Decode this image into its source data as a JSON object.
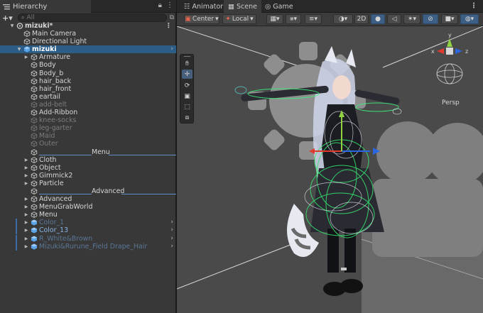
{
  "hierarchy": {
    "tab_label": "Hierarchy",
    "add_label": "+▾",
    "search_placeholder": "All",
    "items": [
      {
        "label": "mizuki*",
        "depth": 0,
        "arrow": "open",
        "icon": "unity-scene-icon",
        "kind": "scene"
      },
      {
        "label": "Main Camera",
        "depth": 1,
        "arrow": "none",
        "icon": "gameobject-cube-icon"
      },
      {
        "label": "Directional Light",
        "depth": 1,
        "arrow": "none",
        "icon": "gameobject-cube-icon"
      },
      {
        "label": "mizuki",
        "depth": 1,
        "arrow": "open",
        "icon": "prefab-cube-icon",
        "selected": true,
        "chevron": true
      },
      {
        "label": "Armature",
        "depth": 2,
        "arrow": "closed",
        "icon": "gameobject-cube-icon"
      },
      {
        "label": "Body",
        "depth": 2,
        "arrow": "none",
        "icon": "gameobject-cube-icon"
      },
      {
        "label": "Body_b",
        "depth": 2,
        "arrow": "none",
        "icon": "gameobject-cube-icon"
      },
      {
        "label": "hair_back",
        "depth": 2,
        "arrow": "none",
        "icon": "gameobject-cube-icon"
      },
      {
        "label": "hair_front",
        "depth": 2,
        "arrow": "none",
        "icon": "gameobject-cube-icon"
      },
      {
        "label": "eartail",
        "depth": 2,
        "arrow": "none",
        "icon": "gameobject-cube-icon"
      },
      {
        "label": "add-belt",
        "depth": 2,
        "arrow": "none",
        "icon": "gameobject-cube-icon",
        "inactive": true
      },
      {
        "label": "Add-Ribbon",
        "depth": 2,
        "arrow": "none",
        "icon": "gameobject-cube-icon"
      },
      {
        "label": "knee-socks",
        "depth": 2,
        "arrow": "none",
        "icon": "gameobject-cube-icon",
        "inactive": true
      },
      {
        "label": "leg-garter",
        "depth": 2,
        "arrow": "none",
        "icon": "gameobject-cube-icon",
        "inactive": true
      },
      {
        "label": "Maid",
        "depth": 2,
        "arrow": "none",
        "icon": "gameobject-cube-icon",
        "inactive": true
      },
      {
        "label": "Outer",
        "depth": 2,
        "arrow": "none",
        "icon": "gameobject-cube-icon",
        "inactive": true
      },
      {
        "label": "Menu",
        "depth": 2,
        "arrow": "none",
        "icon": "gameobject-cube-icon",
        "separator": true
      },
      {
        "label": "Cloth",
        "depth": 2,
        "arrow": "closed",
        "icon": "gameobject-cube-icon"
      },
      {
        "label": "Object",
        "depth": 2,
        "arrow": "closed",
        "icon": "gameobject-cube-icon"
      },
      {
        "label": "Gimmick2",
        "depth": 2,
        "arrow": "closed",
        "icon": "gameobject-cube-icon"
      },
      {
        "label": "Particle",
        "depth": 2,
        "arrow": "closed",
        "icon": "gameobject-cube-icon"
      },
      {
        "label": "Advanced",
        "depth": 2,
        "arrow": "none",
        "icon": "gameobject-cube-icon",
        "separator": true
      },
      {
        "label": "Advanced",
        "depth": 2,
        "arrow": "closed",
        "icon": "gameobject-cube-icon"
      },
      {
        "label": "MenuGrabWorld",
        "depth": 2,
        "arrow": "closed",
        "icon": "gameobject-cube-icon"
      },
      {
        "label": "Menu",
        "depth": 2,
        "arrow": "closed",
        "icon": "gameobject-cube-icon"
      },
      {
        "label": "Color_1",
        "depth": 2,
        "arrow": "closed",
        "icon": "prefab-cube-icon",
        "prefab": true,
        "inactive": true,
        "chevron": true,
        "mark": true
      },
      {
        "label": "Color_13",
        "depth": 2,
        "arrow": "closed",
        "icon": "prefab-cube-icon",
        "prefab": true,
        "chevron": true,
        "mark": true
      },
      {
        "label": "R_White&Brown",
        "depth": 2,
        "arrow": "closed",
        "icon": "prefab-cube-icon",
        "prefab": true,
        "inactive": true,
        "chevron": true,
        "mark": true
      },
      {
        "label": "Mizuki&Rurune_Field Drape_Hair",
        "depth": 2,
        "arrow": "closed",
        "icon": "prefab-cube-icon",
        "prefab": true,
        "inactive": true,
        "chevron": true,
        "mark": true
      }
    ]
  },
  "scene_panel": {
    "tabs": [
      {
        "label": "Animator",
        "icon": "animator-icon",
        "active": false
      },
      {
        "label": "Scene",
        "icon": "scene-grid-icon",
        "active": true
      },
      {
        "label": "Game",
        "icon": "game-controller-icon",
        "active": false
      }
    ],
    "toolbar": {
      "pivot_mode": "Center",
      "pivot_rotation": "Local",
      "mode_2d": "2D"
    },
    "gizmo": {
      "projection_label": "Persp",
      "axes": {
        "y": "y",
        "x": "x",
        "z": "z"
      }
    },
    "tools": [
      "hand-tool-icon",
      "move-tool-icon",
      "rotate-tool-icon",
      "scale-tool-icon",
      "rect-tool-icon",
      "transform-tool-icon"
    ],
    "active_tool": "move-tool-icon"
  },
  "colors": {
    "selection": "#2c5d87",
    "prefab_text": "#87b4e8",
    "x_axis": "#e03a2e",
    "y_axis": "#8fd13f",
    "z_axis": "#2a66e0"
  }
}
